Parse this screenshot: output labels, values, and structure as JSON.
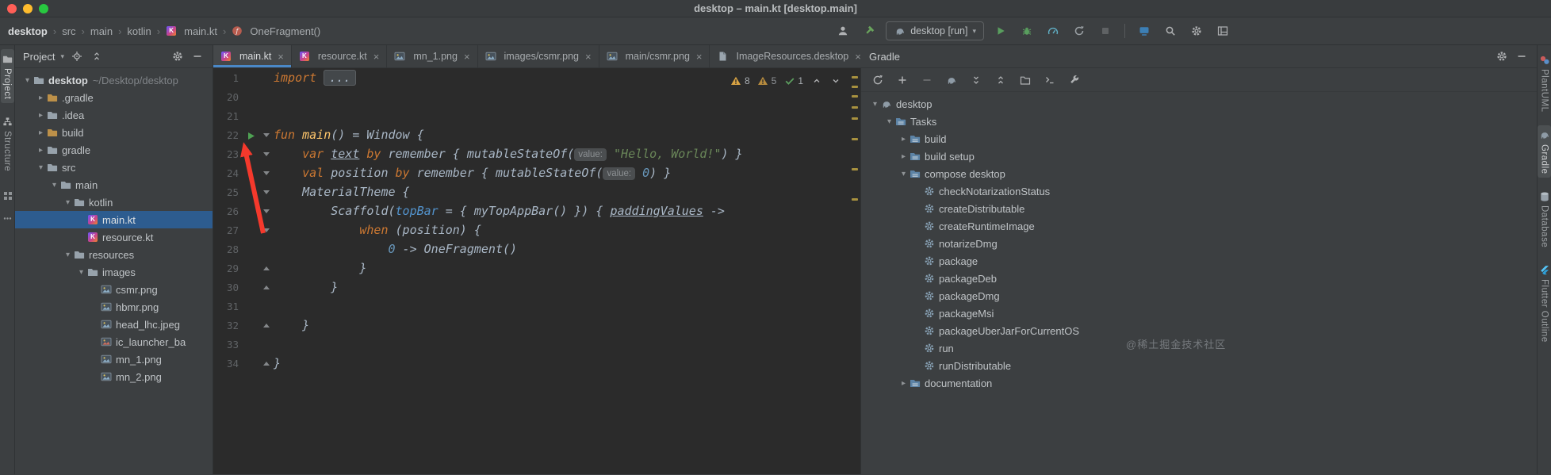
{
  "titlebar": {
    "title": "desktop – main.kt [desktop.main]"
  },
  "navbar": {
    "breadcrumbs": [
      {
        "label": "desktop"
      },
      {
        "label": "src"
      },
      {
        "label": "main"
      },
      {
        "label": "kotlin"
      },
      {
        "label": "main.kt",
        "icon": "kotlin-file"
      },
      {
        "label": "OneFragment()",
        "icon": "function"
      }
    ],
    "run_config": "desktop [run]"
  },
  "left_rail": {
    "buttons": [
      {
        "label": "Project",
        "icon": "folder-tool",
        "active": true
      },
      {
        "label": "Structure",
        "icon": "structure",
        "active": false
      }
    ]
  },
  "right_rail": {
    "buttons": [
      {
        "label": "PlantUML",
        "icon": "plantuml",
        "active": false
      },
      {
        "label": "Gradle",
        "icon": "elephant",
        "active": true
      },
      {
        "label": "Database",
        "icon": "database",
        "active": false
      },
      {
        "label": "Flutter Outline",
        "icon": "flutter",
        "active": false
      }
    ]
  },
  "project_panel": {
    "title": "Project",
    "tree": [
      {
        "label": "desktop",
        "suffix": "~/Desktop/desktop",
        "icon": "folder",
        "indent": 0,
        "arrow": "down",
        "bold": true
      },
      {
        "label": ".gradle",
        "icon": "folder-ex",
        "indent": 1,
        "arrow": "right"
      },
      {
        "label": ".idea",
        "icon": "folder",
        "indent": 1,
        "arrow": "right"
      },
      {
        "label": "build",
        "icon": "folder-ex",
        "indent": 1,
        "arrow": "right"
      },
      {
        "label": "gradle",
        "icon": "folder",
        "indent": 1,
        "arrow": "right"
      },
      {
        "label": "src",
        "icon": "folder",
        "indent": 1,
        "arrow": "down"
      },
      {
        "label": "main",
        "icon": "folder",
        "indent": 2,
        "arrow": "down"
      },
      {
        "label": "kotlin",
        "icon": "folder",
        "indent": 3,
        "arrow": "down"
      },
      {
        "label": "main.kt",
        "icon": "kotlin-file",
        "indent": 4,
        "selected": true
      },
      {
        "label": "resource.kt",
        "icon": "kotlin-file",
        "indent": 4
      },
      {
        "label": "resources",
        "icon": "folder",
        "indent": 3,
        "arrow": "down"
      },
      {
        "label": "images",
        "icon": "folder",
        "indent": 4,
        "arrow": "down"
      },
      {
        "label": "csmr.png",
        "icon": "image-file",
        "indent": 5
      },
      {
        "label": "hbmr.png",
        "icon": "image-file",
        "indent": 5
      },
      {
        "label": "head_lhc.jpeg",
        "icon": "image-file",
        "indent": 5
      },
      {
        "label": "ic_launcher_ba",
        "icon": "launcher-file",
        "indent": 5
      },
      {
        "label": "mn_1.png",
        "icon": "image-file",
        "indent": 5
      },
      {
        "label": "mn_2.png",
        "icon": "image-file",
        "indent": 5
      }
    ]
  },
  "tabs": [
    {
      "label": "main.kt",
      "icon": "kotlin-file",
      "active": true
    },
    {
      "label": "resource.kt",
      "icon": "kotlin-file",
      "active": false
    },
    {
      "label": "mn_1.png",
      "icon": "image-file",
      "active": false
    },
    {
      "label": "images/csmr.png",
      "icon": "image-file",
      "active": false
    },
    {
      "label": "main/csmr.png",
      "icon": "image-file",
      "active": false
    },
    {
      "label": "ImageResources.desktop",
      "icon": "file",
      "active": false
    }
  ],
  "editor": {
    "inspections": {
      "warnings": "8",
      "weak_war)nings_note": "",
      "weak_warnings": "5",
      "passed": "1"
    },
    "lines": [
      {
        "n": "1",
        "t": [
          [
            "import ",
            "kw"
          ],
          [
            "...",
            "fold"
          ]
        ]
      },
      {
        "n": "20",
        "t": []
      },
      {
        "n": "21",
        "t": []
      },
      {
        "n": "22",
        "g": "run",
        "f": "open",
        "t": [
          [
            "fun ",
            "kw"
          ],
          [
            "main",
            "fn"
          ],
          [
            "() = Window {",
            ""
          ]
        ]
      },
      {
        "n": "23",
        "f": "open",
        "t": [
          [
            "    ",
            ""
          ],
          [
            "var ",
            "kw"
          ],
          [
            "text",
            "ul"
          ],
          [
            " ",
            ""
          ],
          [
            "by ",
            "kw"
          ],
          [
            "remember { mutableStateOf(",
            ""
          ],
          [
            "value:",
            "hint"
          ],
          [
            " ",
            ""
          ],
          [
            "\"Hello, World!\"",
            "str"
          ],
          [
            ") }",
            ""
          ]
        ]
      },
      {
        "n": "24",
        "f": "open",
        "t": [
          [
            "    ",
            ""
          ],
          [
            "val ",
            "kw"
          ],
          [
            "position ",
            ""
          ],
          [
            "by ",
            "kw"
          ],
          [
            "remember { mutableStateOf(",
            ""
          ],
          [
            "value:",
            "hint"
          ],
          [
            " ",
            ""
          ],
          [
            "0",
            "num"
          ],
          [
            ") }",
            ""
          ]
        ]
      },
      {
        "n": "25",
        "f": "open",
        "t": [
          [
            "    MaterialTheme {",
            ""
          ]
        ]
      },
      {
        "n": "26",
        "f": "open",
        "t": [
          [
            "        Scaffold(",
            ""
          ],
          [
            "topBar",
            "named"
          ],
          [
            " = { myTopAppBar() }) { ",
            ""
          ],
          [
            "paddingValues",
            "ul"
          ],
          [
            " ->",
            ""
          ]
        ]
      },
      {
        "n": "27",
        "f": "open",
        "t": [
          [
            "            ",
            ""
          ],
          [
            "when",
            "kw"
          ],
          [
            " (position) {",
            ""
          ]
        ]
      },
      {
        "n": "28",
        "t": [
          [
            "                ",
            ""
          ],
          [
            "0",
            "num"
          ],
          [
            " -> OneFragment()",
            ""
          ]
        ]
      },
      {
        "n": "29",
        "f": "end",
        "t": [
          [
            "            }",
            ""
          ]
        ]
      },
      {
        "n": "30",
        "f": "end",
        "t": [
          [
            "        }",
            ""
          ]
        ]
      },
      {
        "n": "31",
        "t": []
      },
      {
        "n": "32",
        "f": "end",
        "t": [
          [
            "    }",
            ""
          ]
        ]
      },
      {
        "n": "33",
        "t": []
      },
      {
        "n": "34",
        "f": "end",
        "t": [
          [
            "}",
            ""
          ]
        ]
      }
    ]
  },
  "gradle_panel": {
    "title": "Gradle",
    "tree": [
      {
        "label": "desktop",
        "icon": "elephant",
        "indent": 0,
        "arrow": "down"
      },
      {
        "label": "Tasks",
        "icon": "tasks-folder",
        "indent": 1,
        "arrow": "down"
      },
      {
        "label": "build",
        "icon": "tasks-folder",
        "indent": 2,
        "arrow": "right"
      },
      {
        "label": "build setup",
        "icon": "tasks-folder",
        "indent": 2,
        "arrow": "right"
      },
      {
        "label": "compose desktop",
        "icon": "tasks-folder",
        "indent": 2,
        "arrow": "down"
      },
      {
        "label": "checkNotarizationStatus",
        "icon": "task",
        "indent": 3
      },
      {
        "label": "createDistributable",
        "icon": "task",
        "indent": 3
      },
      {
        "label": "createRuntimeImage",
        "icon": "task",
        "indent": 3
      },
      {
        "label": "notarizeDmg",
        "icon": "task",
        "indent": 3
      },
      {
        "label": "package",
        "icon": "task",
        "indent": 3
      },
      {
        "label": "packageDeb",
        "icon": "task",
        "indent": 3
      },
      {
        "label": "packageDmg",
        "icon": "task",
        "indent": 3
      },
      {
        "label": "packageMsi",
        "icon": "task",
        "indent": 3
      },
      {
        "label": "packageUberJarForCurrentOS",
        "icon": "task",
        "indent": 3
      },
      {
        "label": "run",
        "icon": "task",
        "indent": 3
      },
      {
        "label": "runDistributable",
        "icon": "task",
        "indent": 3
      },
      {
        "label": "documentation",
        "icon": "tasks-folder",
        "indent": 2,
        "arrow": "right"
      }
    ]
  },
  "watermark": "@稀土掘金技术社区"
}
